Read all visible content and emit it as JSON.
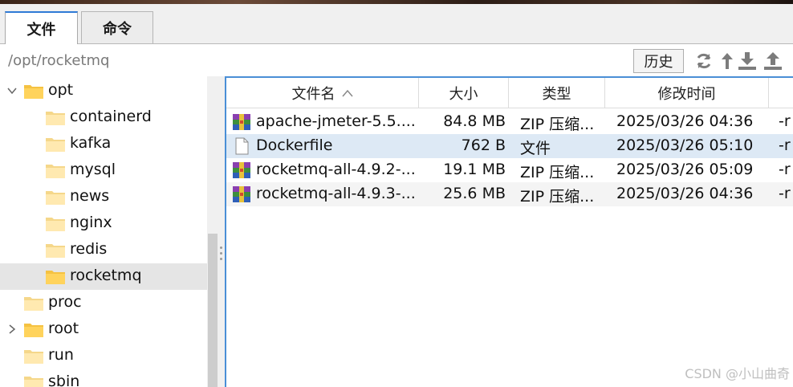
{
  "tabs": [
    {
      "label": "文件",
      "active": true
    },
    {
      "label": "命令",
      "active": false
    }
  ],
  "path": {
    "value": "/opt/rocketmq"
  },
  "toolbar": {
    "history_label": "历史",
    "icons": [
      "refresh-icon",
      "up-arrow-icon",
      "download-icon",
      "upload-icon"
    ]
  },
  "tree": [
    {
      "label": "opt",
      "level": 0,
      "expanded": true
    },
    {
      "label": "containerd",
      "level": 1
    },
    {
      "label": "kafka",
      "level": 1
    },
    {
      "label": "mysql",
      "level": 1
    },
    {
      "label": "news",
      "level": 1
    },
    {
      "label": "nginx",
      "level": 1
    },
    {
      "label": "redis",
      "level": 1
    },
    {
      "label": "rocketmq",
      "level": 1,
      "selected": true
    },
    {
      "label": "proc",
      "level": 0
    },
    {
      "label": "root",
      "level": 0,
      "collapsed": true
    },
    {
      "label": "run",
      "level": 0
    },
    {
      "label": "sbin",
      "level": 0
    }
  ],
  "file_table": {
    "columns": [
      "文件名",
      "大小",
      "类型",
      "修改时间"
    ],
    "sort_indicator": "^",
    "rows": [
      {
        "name": "apache-jmeter-5.5....",
        "size": "84.8 MB",
        "type": "ZIP 压缩...",
        "modified": "2025/03/26 04:36",
        "perm": "-r",
        "icon": "zip-archive-icon"
      },
      {
        "name": "Dockerfile",
        "size": "762 B",
        "type": "文件",
        "modified": "2025/03/26 05:10",
        "perm": "-r",
        "icon": "file-icon",
        "selected": true
      },
      {
        "name": "rocketmq-all-4.9.2-...",
        "size": "19.1 MB",
        "type": "ZIP 压缩...",
        "modified": "2025/03/26 05:09",
        "perm": "-r",
        "icon": "zip-archive-icon"
      },
      {
        "name": "rocketmq-all-4.9.3-...",
        "size": "25.6 MB",
        "type": "ZIP 压缩...",
        "modified": "2025/03/26 04:36",
        "perm": "-r",
        "icon": "zip-archive-icon"
      }
    ]
  },
  "watermark": "CSDN @小山曲奇",
  "colors": {
    "accent": "#2f7ad6",
    "selection": "#dde9f5",
    "tree_selection": "#e5e5e5",
    "folder": "#f5c242"
  }
}
